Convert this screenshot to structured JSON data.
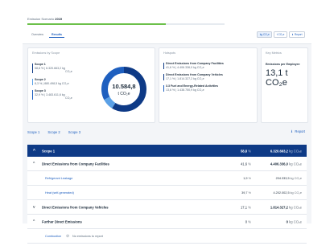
{
  "header": {
    "title_prefix": "Emission Scenario",
    "title_year": "2019",
    "progress": 0.7,
    "tabs": [
      {
        "label": "Overview"
      },
      {
        "label": "Results"
      }
    ],
    "units": [
      {
        "label": "kg CO₂e"
      },
      {
        "label": "t CO₂e"
      }
    ],
    "report_label": "Report"
  },
  "emissions_by_scope": {
    "title": "Emissions by Scope",
    "total_value": "10.584,8",
    "total_unit": "t CO₂e",
    "items": [
      {
        "name": "Scope 1",
        "value": "58,8 %  |  6.320.663,2  kg",
        "unit": "CO₂e",
        "color": "#0e3a86"
      },
      {
        "name": "Scope 2",
        "value": "8,3 %  |  880.498,5  kg CO₂e",
        "unit": "",
        "color": "#5aa0e6"
      },
      {
        "name": "Scope 3",
        "value": "32,9 %  |  3.483.611,6  kg",
        "unit": "CO₂e",
        "color": "#1e5fbf"
      }
    ]
  },
  "hotspots": {
    "title": "Hotspots",
    "items": [
      {
        "name": "Direct Emissions from Company Facilities",
        "value": "41,6 %  |  4.406.336,0  kg CO₂e",
        "color": "#0e3a86"
      },
      {
        "name": "Direct Emissions from Company Vehicles",
        "value": "17,1 %  |  1.814.327,2  kg CO₂e",
        "color": "#0e3a86"
      },
      {
        "name": "3.3 Fuel and Energy-Related Activities",
        "value": "13,6 %  |  1.438.750,9  kg CO₂e",
        "color": "#1e5fbf"
      }
    ]
  },
  "key_metrics": {
    "title": "Key Metrics",
    "label": "Emissions per Employee",
    "value": "13,1 t CO₂e"
  },
  "scope_tabs": [
    {
      "label": "Scope 1"
    },
    {
      "label": "Scope 2"
    },
    {
      "label": "Scope 3"
    }
  ],
  "report_link": "Report",
  "table": {
    "scope": {
      "label": "Scope 1",
      "pct": "58,8",
      "pct_unit": "%",
      "abs": "6.320.663,2",
      "abs_unit": "kg CO₂e"
    },
    "rows": [
      {
        "kind": "sub",
        "chev": "^",
        "label": "Direct Emissions from Company Facilities",
        "pct": "41,6",
        "pct_unit": "%",
        "abs": "4.406.336,0",
        "abs_unit": "kg CO₂e"
      },
      {
        "kind": "leaf",
        "label": "Refrigerant Leakage",
        "pct": "1,9",
        "pct_unit": "%",
        "abs": "204.333,5",
        "abs_unit": "kg CO₂e"
      },
      {
        "kind": "leaf",
        "label": "Heat (self-generated)",
        "pct": "39,7",
        "pct_unit": "%",
        "abs": "4.202.002,5",
        "abs_unit": "kg CO₂e"
      },
      {
        "kind": "sub",
        "chev": "v",
        "label": "Direct Emissions from Company Vehicles",
        "pct": "17,1",
        "pct_unit": "%",
        "abs": "1.814.327,2",
        "abs_unit": "kg CO₂e"
      },
      {
        "kind": "sub",
        "chev": "^",
        "label": "Further Direct Emissions",
        "pct": "0",
        "pct_unit": "%",
        "abs": "0",
        "abs_unit": "kg CO₂e"
      }
    ],
    "none_row": {
      "label": "Combustion",
      "text": "No emissions to report"
    }
  }
}
